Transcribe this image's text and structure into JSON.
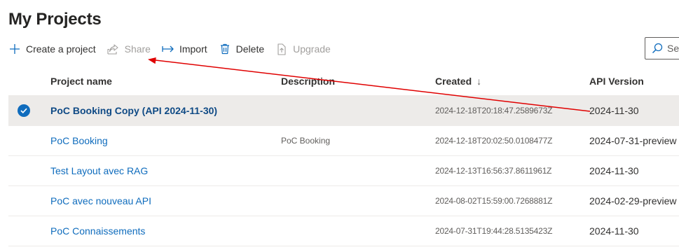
{
  "page": {
    "title": "My Projects"
  },
  "toolbar": {
    "create_label": "Create a project",
    "share_label": "Share",
    "import_label": "Import",
    "delete_label": "Delete",
    "upgrade_label": "Upgrade",
    "search_placeholder": "Se",
    "icons": [
      "plus-icon",
      "share-icon",
      "import-icon",
      "trash-icon",
      "upgrade-icon",
      "search-icon"
    ]
  },
  "grid": {
    "headers": {
      "name": "Project name",
      "description": "Description",
      "created": "Created",
      "created_sort": "↓",
      "api": "API Version"
    },
    "rows": [
      {
        "selected": true,
        "name": "PoC Booking Copy (API 2024-11-30)",
        "description": "",
        "created": "2024-12-18T20:18:47.2589673Z",
        "api": "2024-11-30"
      },
      {
        "selected": false,
        "name": "PoC Booking",
        "description": "PoC Booking",
        "created": "2024-12-18T20:02:50.0108477Z",
        "api": "2024-07-31-preview"
      },
      {
        "selected": false,
        "name": "Test Layout avec RAG",
        "description": "",
        "created": "2024-12-13T16:56:37.8611961Z",
        "api": "2024-11-30"
      },
      {
        "selected": false,
        "name": "PoC avec nouveau API",
        "description": "",
        "created": "2024-08-02T15:59:00.7268881Z",
        "api": "2024-02-29-preview"
      },
      {
        "selected": false,
        "name": "PoC Connaissements",
        "description": "",
        "created": "2024-07-31T19:44:28.5135423Z",
        "api": "2024-11-30"
      }
    ]
  },
  "colors": {
    "accent": "#0f6cbd",
    "selected_row": "#edebe9",
    "annotation_arrow": "#e00000",
    "disabled_text": "#a19f9d"
  }
}
